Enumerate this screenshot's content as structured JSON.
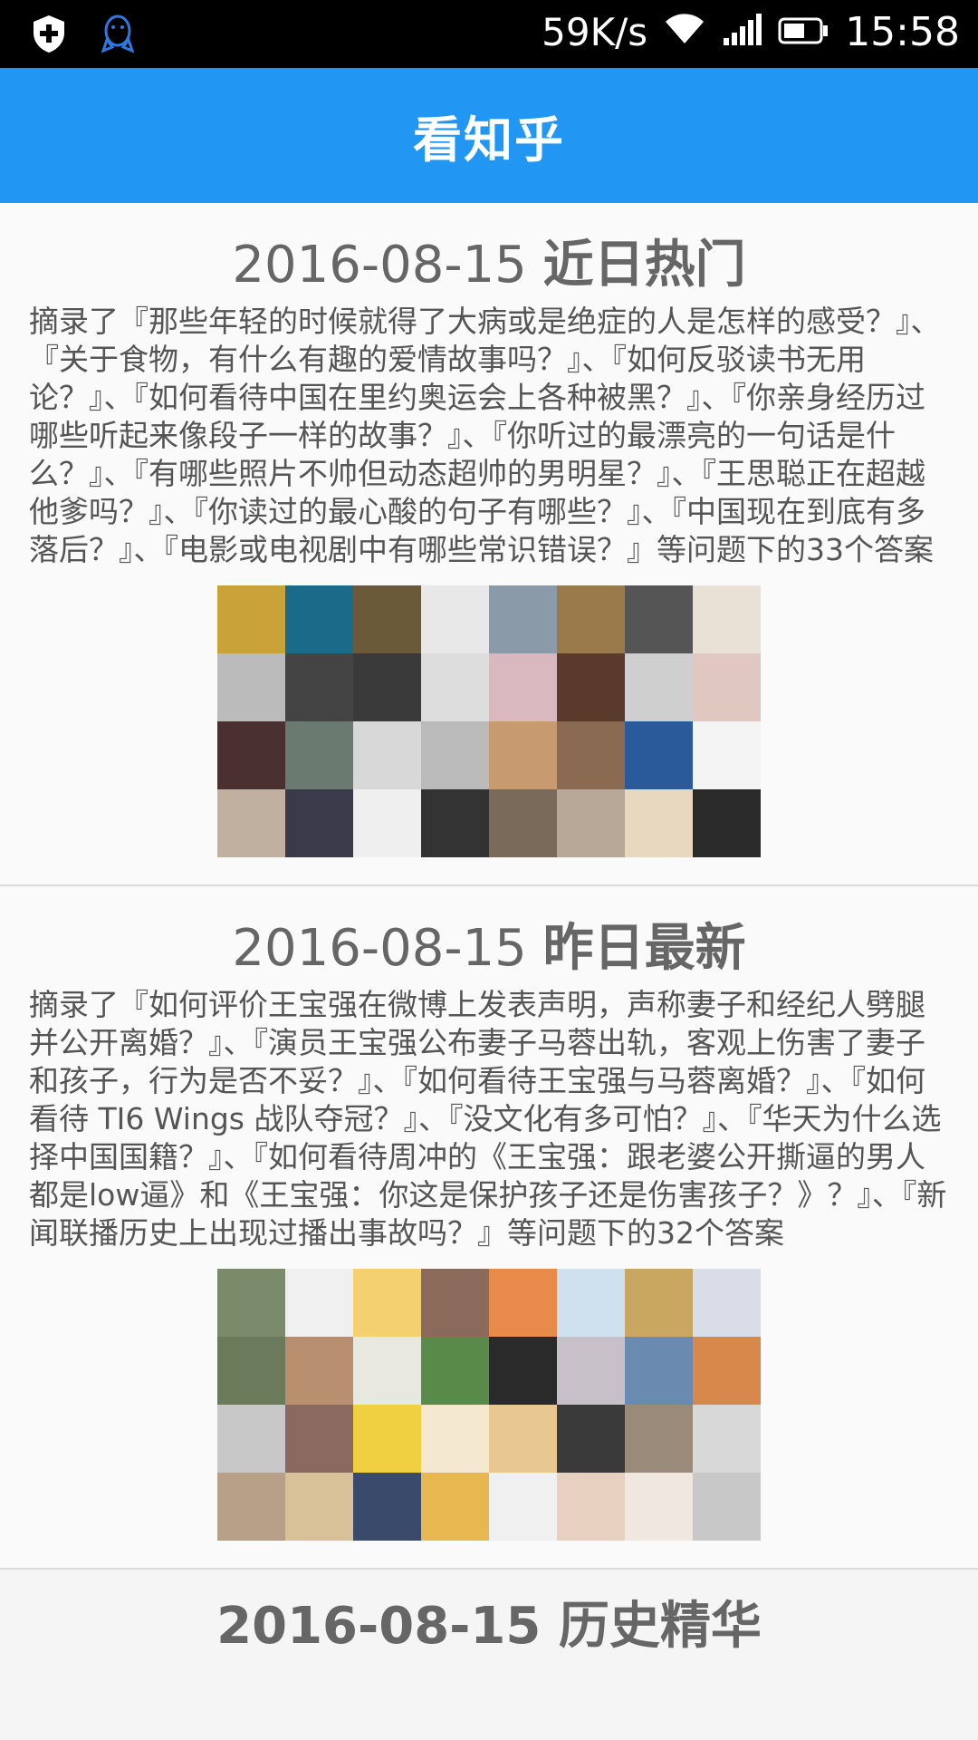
{
  "status_bar": {
    "left_icons": [
      "shield-plus-icon",
      "qq-penguin-icon"
    ],
    "net_speed": "59K/s",
    "time": "15:58"
  },
  "app_bar": {
    "title": "看知乎"
  },
  "cards": [
    {
      "date": "2016-08-15",
      "category": "近日热门",
      "summary": "摘录了『那些年轻的时候就得了大病或是绝症的人是怎样的感受？』、『关于食物，有什么有趣的爱情故事吗？』、『如何反驳读书无用论？』、『如何看待中国在里约奥运会上各种被黑？』、『你亲身经历过哪些听起来像段子一样的故事？』、『你听过的最漂亮的一句话是什么？』、『有哪些照片不帅但动态超帅的男明星？』、『王思聪正在超越他爹吗？』、『你读过的最心酸的句子有哪些？』、『中国现在到底有多落后？』、『电影或电视剧中有哪些常识错误？』等问题下的33个答案",
      "avatar_colors": [
        "#c9a23a",
        "#1a6b8a",
        "#6b5a3a",
        "#e8e8e8",
        "#8a9aa8",
        "#9a7a4a",
        "#555555",
        "#e9e1d6",
        "#bbbbbb",
        "#444444",
        "#3a3a3a",
        "#dddddd",
        "#d9b8c0",
        "#5a3a2a",
        "#cfcfcf",
        "#e0c8c0",
        "#4a3030",
        "#6a7a70",
        "#d8d8d8",
        "#bababa",
        "#c89a70",
        "#8a6a50",
        "#2a5a9a",
        "#f4f4f4",
        "#c0b0a0",
        "#3a3a4a",
        "#efefef",
        "#333333",
        "#7a6a5a",
        "#b8a898",
        "#e8d8c0",
        "#2a2a2a"
      ]
    },
    {
      "date": "2016-08-15",
      "category": "昨日最新",
      "summary": "摘录了『如何评价王宝强在微博上发表声明，声称妻子和经纪人劈腿并公开离婚？』、『演员王宝强公布妻子马蓉出轨，客观上伤害了妻子和孩子，行为是否不妥？』、『如何看待王宝强与马蓉离婚？』、『如何看待 TI6 Wings 战队夺冠？』、『没文化有多可怕？』、『华天为什么选择中国国籍？』、『如何看待周冲的《王宝强：跟老婆公开撕逼的男人都是low逼》和《王宝强：你这是保护孩子还是伤害孩子？》？』、『新闻联播历史上出现过播出事故吗？』等问题下的32个答案",
      "avatar_colors": [
        "#7a8a6a",
        "#f0f0f0",
        "#f4d070",
        "#8a6a5a",
        "#e88a4a",
        "#cfe0ef",
        "#c8a860",
        "#d8dde8",
        "#6a7a5a",
        "#b89070",
        "#e8e8e0",
        "#5a8a4a",
        "#2a2a2a",
        "#c8c0c8",
        "#6a8ab0",
        "#d8884a",
        "#c8c8c8",
        "#8a6a60",
        "#f0d040",
        "#f4e8d0",
        "#e8c890",
        "#3a3a3a",
        "#9a8a7a",
        "#d8d8d8",
        "#b8a088",
        "#d8c098",
        "#3a4a6a",
        "#e8b850",
        "#f0f0f0",
        "#e8d0c0",
        "#f0e8e0",
        "#c8c8c8"
      ]
    }
  ],
  "next_card_partial_title": "2016-08-15 历史精华"
}
